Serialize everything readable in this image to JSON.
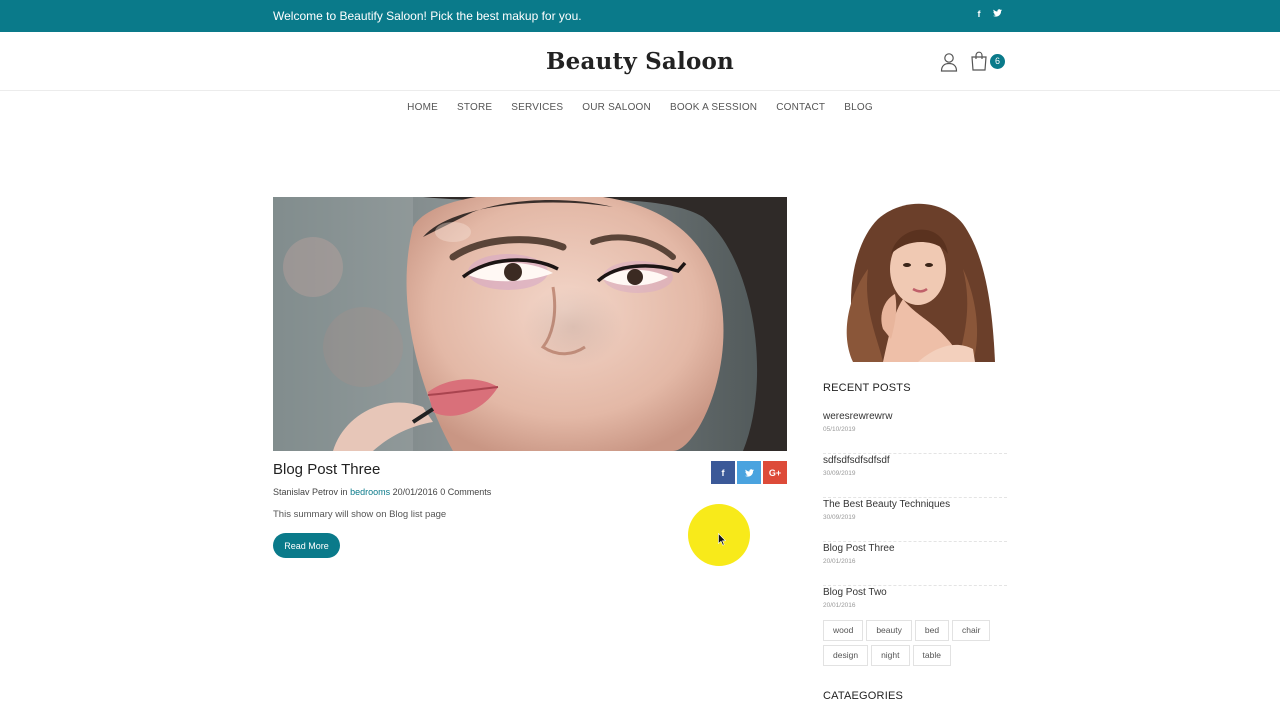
{
  "topbar": {
    "welcome": "Welcome to Beautify Saloon! Pick the best makup for you.",
    "social": [
      {
        "icon": "facebook-icon",
        "glyph": "f"
      },
      {
        "icon": "twitter-icon",
        "glyph": "t"
      }
    ]
  },
  "header": {
    "logo": "Beauty Saloon",
    "cart_count": "6"
  },
  "nav": [
    "HOME",
    "STORE",
    "SERVICES",
    "OUR SALOON",
    "BOOK A SESSION",
    "CONTACT",
    "BLOG"
  ],
  "post": {
    "title": "Blog Post Three",
    "author": "Stanislav Petrov",
    "in_label": "in",
    "category": "bedrooms",
    "date": "20/01/2016",
    "comments": "0 Comments",
    "summary": "This summary will show on Blog list page",
    "read_more": "Read More",
    "share": [
      {
        "icon": "facebook-icon",
        "glyph": "f"
      },
      {
        "icon": "twitter-icon",
        "glyph": "t"
      },
      {
        "icon": "google-plus-icon",
        "glyph": "G+"
      }
    ]
  },
  "sidebar": {
    "recent_heading": "RECENT POSTS",
    "recent": [
      {
        "title": "weresrewrewrw",
        "date": "05/10/2019"
      },
      {
        "title": "sdfsdfsdfsdfsdf",
        "date": "30/09/2019"
      },
      {
        "title": "The Best Beauty Techniques",
        "date": "30/09/2019"
      },
      {
        "title": "Blog Post Three",
        "date": "20/01/2016"
      },
      {
        "title": "Blog Post Two",
        "date": "20/01/2016"
      }
    ],
    "tags": [
      "wood",
      "beauty",
      "bed",
      "chair",
      "design",
      "night",
      "table"
    ],
    "categories_heading": "CATAEGORIES"
  },
  "colors": {
    "accent": "#0a7a8a",
    "facebook": "#3b5998",
    "twitter": "#4aa3df",
    "google_plus": "#dd4b39",
    "cursor_highlight": "#f8ea1a"
  }
}
